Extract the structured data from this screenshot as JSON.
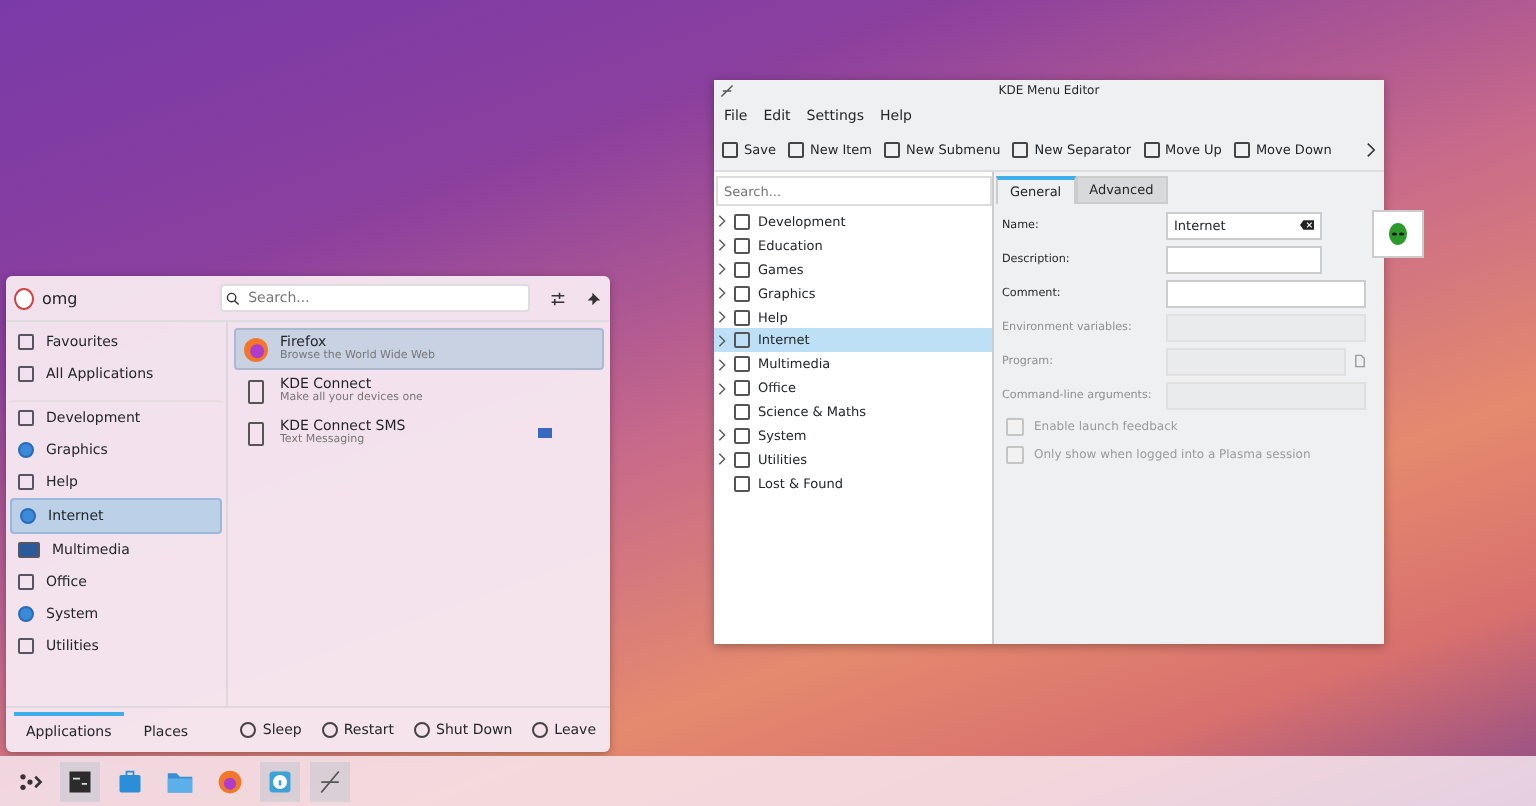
{
  "launcher": {
    "user": "omg",
    "search_placeholder": "Search...",
    "categories": [
      {
        "label": "Favourites",
        "selected": false
      },
      {
        "label": "All Applications",
        "selected": false
      },
      {
        "label": "Development",
        "selected": false
      },
      {
        "label": "Graphics",
        "selected": false
      },
      {
        "label": "Help",
        "selected": false
      },
      {
        "label": "Internet",
        "selected": true
      },
      {
        "label": "Multimedia",
        "selected": false
      },
      {
        "label": "Office",
        "selected": false
      },
      {
        "label": "System",
        "selected": false
      },
      {
        "label": "Utilities",
        "selected": false
      }
    ],
    "apps": [
      {
        "name": "Firefox",
        "description": "Browse the World Wide Web",
        "selected": true,
        "badge": false
      },
      {
        "name": "KDE Connect",
        "description": "Make all your devices one",
        "selected": false,
        "badge": false
      },
      {
        "name": "KDE Connect SMS",
        "description": "Text Messaging",
        "selected": false,
        "badge": true
      }
    ],
    "tabs": [
      {
        "label": "Applications",
        "selected": true
      },
      {
        "label": "Places",
        "selected": false
      }
    ],
    "power": [
      "Sleep",
      "Restart",
      "Shut Down",
      "Leave"
    ]
  },
  "editor": {
    "title": "KDE Menu Editor",
    "menu": [
      "File",
      "Edit",
      "Settings",
      "Help"
    ],
    "toolbar": [
      "Save",
      "New Item",
      "New Submenu",
      "New Separator",
      "Move Up",
      "Move Down"
    ],
    "search_placeholder": "Search...",
    "tree": [
      {
        "label": "Development",
        "expandable": true,
        "selected": false
      },
      {
        "label": "Education",
        "expandable": true,
        "selected": false
      },
      {
        "label": "Games",
        "expandable": true,
        "selected": false
      },
      {
        "label": "Graphics",
        "expandable": true,
        "selected": false
      },
      {
        "label": "Help",
        "expandable": true,
        "selected": false
      },
      {
        "label": "Internet",
        "expandable": true,
        "selected": true
      },
      {
        "label": "Multimedia",
        "expandable": true,
        "selected": false
      },
      {
        "label": "Office",
        "expandable": true,
        "selected": false
      },
      {
        "label": "Science & Maths",
        "expandable": false,
        "selected": false
      },
      {
        "label": "System",
        "expandable": true,
        "selected": false
      },
      {
        "label": "Utilities",
        "expandable": true,
        "selected": false
      },
      {
        "label": "Lost & Found",
        "expandable": false,
        "selected": false
      }
    ],
    "tabs": [
      {
        "label": "General",
        "selected": true
      },
      {
        "label": "Advanced",
        "selected": false
      }
    ],
    "fields": [
      {
        "label": "Name:",
        "value": "Internet",
        "disabled": false,
        "kind": "clear"
      },
      {
        "label": "Description:",
        "disabled": false,
        "kind": "short"
      },
      {
        "label": "Comment:",
        "disabled": false,
        "kind": "wide"
      },
      {
        "label": "Environment variables:",
        "disabled": true,
        "kind": "wide"
      },
      {
        "label": "Program:",
        "disabled": true,
        "kind": "browse"
      },
      {
        "label": "Command-line arguments:",
        "disabled": true,
        "kind": "wide"
      }
    ],
    "checkboxes": [
      {
        "label": "Enable launch feedback",
        "checked": false,
        "disabled": true
      },
      {
        "label": "Only show when logged into a Plasma session",
        "checked": false,
        "disabled": true
      }
    ]
  }
}
